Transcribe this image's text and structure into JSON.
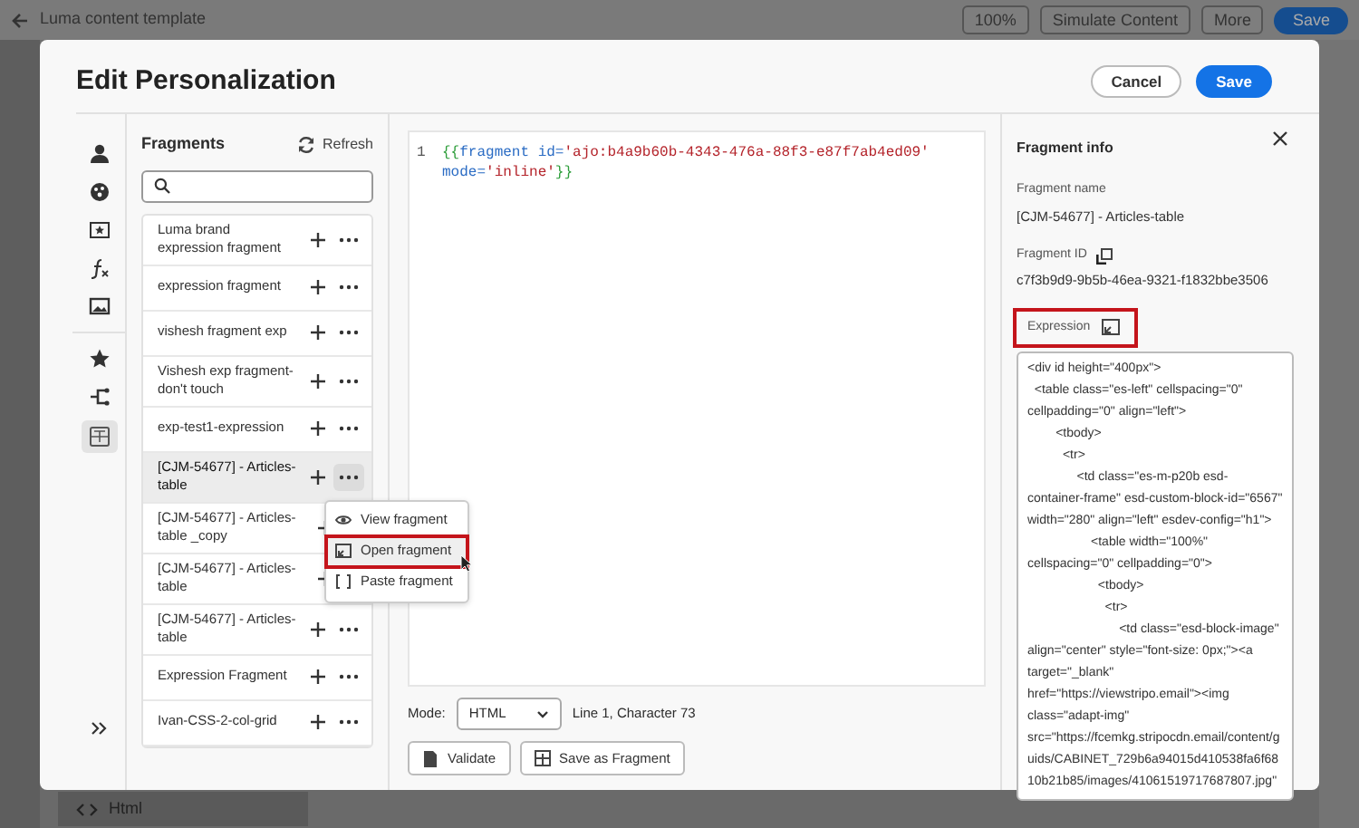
{
  "background": {
    "title": "Luma content template",
    "zoom": "100%",
    "simulate": "Simulate Content",
    "more": "More",
    "save": "Save",
    "bottom_tab": "Html"
  },
  "dialog": {
    "title": "Edit Personalization",
    "buttons": [
      {
        "label": "Cancel",
        "kind": "secondary"
      },
      {
        "label": "Save",
        "kind": "primary"
      }
    ]
  },
  "rail": [
    {
      "selected": false
    },
    {
      "selected": false
    },
    {
      "selected": false
    },
    {
      "selected": false
    },
    {
      "selected": false
    },
    {
      "selected": false
    },
    {
      "selected": false
    },
    {
      "selected": true
    }
  ],
  "fragments": {
    "title": "Fragments",
    "refresh": "Refresh",
    "items": [
      {
        "name": "Luma brand expression fragment",
        "selected": false,
        "menu_open": false
      },
      {
        "name": "expression fragment",
        "selected": false,
        "menu_open": false
      },
      {
        "name": "vishesh fragment exp",
        "selected": false,
        "menu_open": false
      },
      {
        "name": "Vishesh exp fragment- don't touch",
        "selected": false,
        "menu_open": false
      },
      {
        "name": "exp-test1-expression",
        "selected": false,
        "menu_open": false
      },
      {
        "name": "[CJM-54677] - Articles- table",
        "selected": true,
        "menu_open": true
      },
      {
        "name": "[CJM-54677] - Articles- table _copy",
        "selected": false,
        "menu_open": false
      },
      {
        "name": "[CJM-54677] - Articles- table",
        "selected": false,
        "menu_open": false
      },
      {
        "name": "[CJM-54677] - Articles- table",
        "selected": false,
        "menu_open": false
      },
      {
        "name": "Expression Fragment",
        "selected": false,
        "menu_open": false
      },
      {
        "name": "Ivan-CSS-2-col-grid",
        "selected": false,
        "menu_open": false
      }
    ]
  },
  "menu": {
    "items": [
      {
        "label": "View fragment",
        "highlighted": false
      },
      {
        "label": "Open fragment",
        "highlighted": true
      },
      {
        "label": "Paste fragment",
        "highlighted": false
      }
    ]
  },
  "editor": {
    "line_number": "1",
    "code": [
      {
        "text": "{{",
        "kind": "brace"
      },
      {
        "text": "fragment",
        "kind": "keyword"
      },
      {
        "text": " id=",
        "kind": "keyword"
      },
      {
        "text": "'ajo:b4a9b60b-4343-476a-88f3-e87f7ab4ed09'",
        "kind": "string"
      },
      {
        "text": " mode=",
        "kind": "keyword"
      },
      {
        "text": "'inline'",
        "kind": "string"
      },
      {
        "text": "}}",
        "kind": "brace"
      }
    ],
    "mode_label": "Mode:",
    "mode": "HTML",
    "position": "Line 1, Character 73",
    "buttons": [
      "Validate",
      "Save as Fragment"
    ]
  },
  "info": {
    "title": "Fragment info",
    "name_label": "Fragment name",
    "name": "[CJM-54677] - Articles-table",
    "id_label": "Fragment ID",
    "id": "c7f3b9d9-9b5b-46ea-9321-f1832bbe3506",
    "expression_label": "Expression",
    "expression_highlighted": true,
    "expression": [
      "<div id height=\"400px\">",
      "  <table class=\"es-left\" cellspacing=\"0\" cellpadding=\"0\" align=\"left\">",
      "        <tbody>",
      "          <tr>",
      "              <td class=\"es-m-p20b esd-container-frame\" esd-custom-block-id=\"6567\" width=\"280\" align=\"left\" esdev-config=\"h1\">",
      "                  <table width=\"100%\" cellspacing=\"0\" cellpadding=\"0\">",
      "                    <tbody>",
      "                      <tr>",
      "                          <td class=\"esd-block-image\" align=\"center\" style=\"font-size: 0px;\"><a target=\"_blank\" href=\"https://viewstripo.email\"><img class=\"adapt-img\" src=\"https://fcemkg.stripocdn.email/content/guids/CABINET_729b6a94015d410538fa6f6810b21b85/images/41061519717687807.jpg\""
    ]
  }
}
